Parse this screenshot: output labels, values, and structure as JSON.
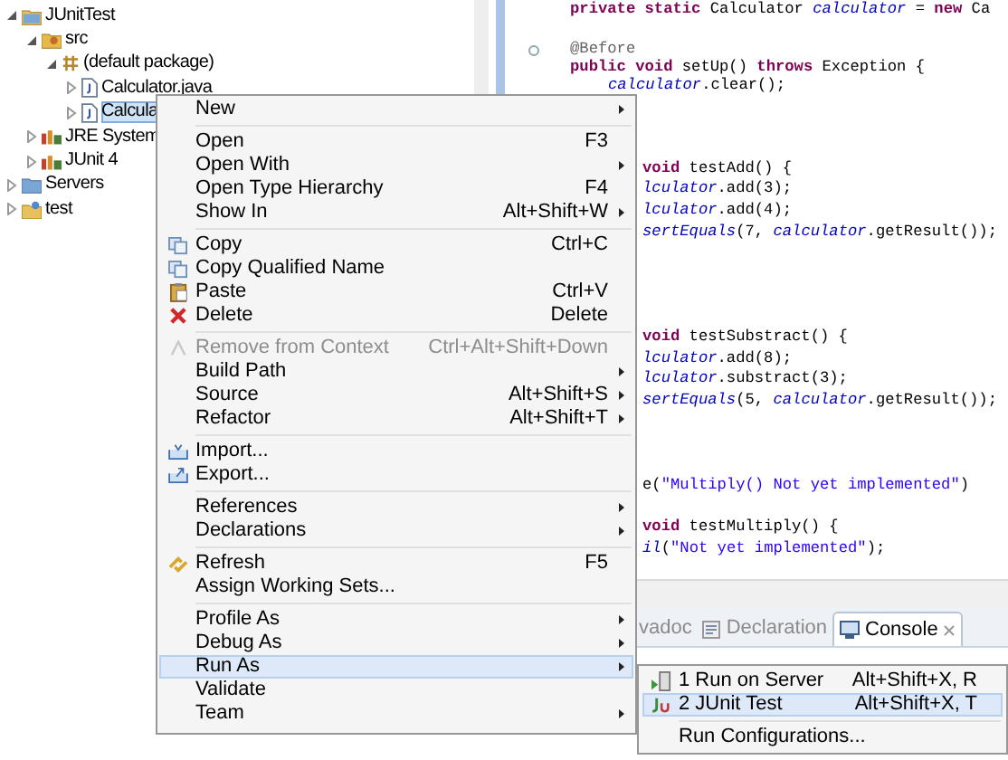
{
  "tree": [
    {
      "label": "JUnitTest",
      "kind": "project",
      "expanded": true,
      "selected": false,
      "children": [
        {
          "label": "src",
          "kind": "source",
          "expanded": true,
          "selected": false,
          "children": [
            {
              "label": "(default package)",
              "kind": "package",
              "expanded": true,
              "selected": false,
              "children": [
                {
                  "label": "Calculator.java",
                  "kind": "java",
                  "expanded": false,
                  "selected": false
                },
                {
                  "label": "Calcula",
                  "kind": "java",
                  "expanded": false,
                  "selected": true
                }
              ]
            }
          ]
        },
        {
          "label": "JRE System",
          "kind": "library",
          "expanded": false,
          "selected": false
        },
        {
          "label": "JUnit 4",
          "kind": "library",
          "expanded": false,
          "selected": false
        }
      ]
    },
    {
      "label": "Servers",
      "kind": "folder",
      "expanded": false,
      "selected": false
    },
    {
      "label": "test",
      "kind": "project2",
      "expanded": false,
      "selected": false
    }
  ],
  "editor": {
    "lines": [
      {
        "kind": "top",
        "tokens": [
          {
            "kind": "kw",
            "text": "private static"
          },
          {
            "kind": "plain",
            "text": " Calculator "
          },
          {
            "kind": "field",
            "text": "calculator"
          },
          {
            "kind": "plain",
            "text": " = "
          },
          {
            "kind": "kw",
            "text": "new"
          },
          {
            "kind": "plain",
            "text": " Ca"
          }
        ]
      },
      {
        "kind": "blank"
      },
      {
        "kind": "top",
        "fold": true,
        "tokens": [
          {
            "kind": "ann",
            "text": "@Before"
          }
        ]
      },
      {
        "kind": "top",
        "tokens": [
          {
            "kind": "kw",
            "text": "public void"
          },
          {
            "kind": "plain",
            "text": " setUp() "
          },
          {
            "kind": "kw",
            "text": "throws"
          },
          {
            "kind": "plain",
            "text": " Exception {"
          }
        ]
      },
      {
        "kind": "nested",
        "tokens": [
          {
            "kind": "field",
            "text": "calculator"
          },
          {
            "kind": "plain",
            "text": ".clear();"
          }
        ]
      },
      {
        "kind": "blank"
      },
      {
        "kind": "blank"
      },
      {
        "kind": "blank"
      },
      {
        "kind": "side",
        "tokens": [
          {
            "kind": "kw",
            "text": "void"
          },
          {
            "kind": "plain",
            "text": " testAdd() {"
          }
        ]
      },
      {
        "kind": "side",
        "tokens": [
          {
            "kind": "field",
            "text": "lculator"
          },
          {
            "kind": "plain",
            "text": ".add(3);"
          }
        ]
      },
      {
        "kind": "side",
        "tokens": [
          {
            "kind": "field",
            "text": "lculator"
          },
          {
            "kind": "plain",
            "text": ".add(4);"
          }
        ]
      },
      {
        "kind": "side",
        "tokens": [
          {
            "kind": "field",
            "text": "sertEquals"
          },
          {
            "kind": "plain",
            "text": "(7, "
          },
          {
            "kind": "field",
            "text": "calculator"
          },
          {
            "kind": "plain",
            "text": ".getResult());"
          }
        ]
      },
      {
        "kind": "blank"
      },
      {
        "kind": "blank"
      },
      {
        "kind": "blank"
      },
      {
        "kind": "blank"
      },
      {
        "kind": "side",
        "tokens": [
          {
            "kind": "kw",
            "text": "void"
          },
          {
            "kind": "plain",
            "text": " testSubstract() {"
          }
        ]
      },
      {
        "kind": "side",
        "tokens": [
          {
            "kind": "field",
            "text": "lculator"
          },
          {
            "kind": "plain",
            "text": ".add(8);"
          }
        ]
      },
      {
        "kind": "side",
        "tokens": [
          {
            "kind": "field",
            "text": "lculator"
          },
          {
            "kind": "plain",
            "text": ".substract(3);"
          }
        ]
      },
      {
        "kind": "side",
        "tokens": [
          {
            "kind": "field",
            "text": "sertEquals"
          },
          {
            "kind": "plain",
            "text": "(5, "
          },
          {
            "kind": "field",
            "text": "calculator"
          },
          {
            "kind": "plain",
            "text": ".getResult());"
          }
        ]
      },
      {
        "kind": "blank"
      },
      {
        "kind": "blank"
      },
      {
        "kind": "blank"
      },
      {
        "kind": "side",
        "tokens": [
          {
            "kind": "plain",
            "text": "e("
          },
          {
            "kind": "str",
            "text": "\"Multiply() Not yet implemented\""
          },
          {
            "kind": "plain",
            "text": ")"
          }
        ]
      },
      {
        "kind": "blank"
      },
      {
        "kind": "side",
        "tokens": [
          {
            "kind": "kw",
            "text": "void"
          },
          {
            "kind": "plain",
            "text": " testMultiply() {"
          }
        ]
      },
      {
        "kind": "side",
        "tokens": [
          {
            "kind": "field",
            "text": "il"
          },
          {
            "kind": "plain",
            "text": "("
          },
          {
            "kind": "str",
            "text": "\"Not yet implemented\""
          },
          {
            "kind": "plain",
            "text": ");"
          }
        ]
      }
    ]
  },
  "bottom_tabs": [
    {
      "label": "vadoc",
      "kind": "plain",
      "selected": false
    },
    {
      "label": "Declaration",
      "kind": "declaration",
      "selected": false
    },
    {
      "label": "Console",
      "kind": "console",
      "selected": true
    }
  ],
  "context_menu": [
    {
      "kind": "plain",
      "label": "New",
      "submenu": true
    },
    {
      "kind": "separator"
    },
    {
      "kind": "plain",
      "label": "Open",
      "shortcut": "F3"
    },
    {
      "kind": "plain",
      "label": "Open With",
      "submenu": true
    },
    {
      "kind": "plain",
      "label": "Open Type Hierarchy",
      "shortcut": "F4"
    },
    {
      "kind": "plain",
      "label": "Show In",
      "shortcut": "Alt+Shift+W",
      "submenu": true
    },
    {
      "kind": "separator"
    },
    {
      "kind": "copy",
      "label": "Copy",
      "shortcut": "Ctrl+C"
    },
    {
      "kind": "copy",
      "label": "Copy Qualified Name"
    },
    {
      "kind": "paste",
      "label": "Paste",
      "shortcut": "Ctrl+V"
    },
    {
      "kind": "delete",
      "label": "Delete",
      "shortcut": "Delete"
    },
    {
      "kind": "separator"
    },
    {
      "kind": "remove",
      "label": "Remove from Context",
      "shortcut": "Ctrl+Alt+Shift+Down",
      "disabled": true
    },
    {
      "kind": "plain",
      "label": "Build Path",
      "submenu": true
    },
    {
      "kind": "plain",
      "label": "Source",
      "shortcut": "Alt+Shift+S",
      "submenu": true
    },
    {
      "kind": "plain",
      "label": "Refactor",
      "shortcut": "Alt+Shift+T",
      "submenu": true
    },
    {
      "kind": "separator"
    },
    {
      "kind": "import",
      "label": "Import..."
    },
    {
      "kind": "export",
      "label": "Export..."
    },
    {
      "kind": "separator"
    },
    {
      "kind": "plain",
      "label": "References",
      "submenu": true
    },
    {
      "kind": "plain",
      "label": "Declarations",
      "submenu": true
    },
    {
      "kind": "separator"
    },
    {
      "kind": "refresh",
      "label": "Refresh",
      "shortcut": "F5"
    },
    {
      "kind": "plain",
      "label": "Assign Working Sets..."
    },
    {
      "kind": "separator"
    },
    {
      "kind": "plain",
      "label": "Profile As",
      "submenu": true
    },
    {
      "kind": "plain",
      "label": "Debug As",
      "submenu": true
    },
    {
      "kind": "plain",
      "label": "Run As",
      "submenu": true,
      "selected": true
    },
    {
      "kind": "plain",
      "label": "Validate"
    },
    {
      "kind": "plain",
      "label": "Team",
      "submenu": true
    }
  ],
  "submenu": [
    {
      "kind": "server",
      "label": "1 Run on Server",
      "shortcut": "Alt+Shift+X, R",
      "selected": false
    },
    {
      "kind": "junit",
      "label": "2 JUnit Test",
      "shortcut": "Alt+Shift+X, T",
      "selected": true
    },
    {
      "kind": "separator"
    },
    {
      "kind": "plain",
      "label": "Run Configurations...",
      "selected": false
    }
  ]
}
